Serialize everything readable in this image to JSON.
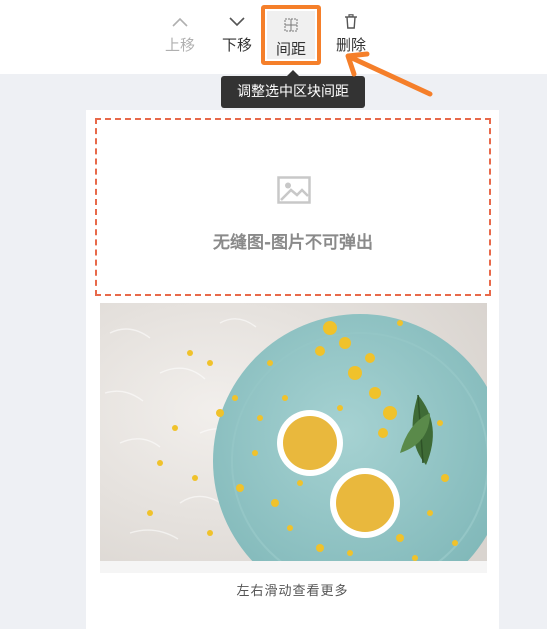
{
  "toolbar": {
    "move_up": {
      "label": "上移",
      "icon": "chevron-up-icon",
      "disabled": true
    },
    "move_down": {
      "label": "下移",
      "icon": "chevron-down-icon"
    },
    "spacing": {
      "label": "间距",
      "icon": "grid-icon",
      "highlight_color": "#f57f2a"
    },
    "delete": {
      "label": "删除",
      "icon": "trash-icon"
    }
  },
  "tooltip": {
    "text": "调整选中区块间距"
  },
  "block": {
    "placeholder_text": "无缝图-图片不可弹出",
    "placeholder_icon": "image-icon",
    "border_color": "#e8694a"
  },
  "gallery": {
    "caption": "左右滑动查看更多"
  },
  "colors": {
    "accent": "#f57f2a",
    "canvas_bg": "#eef0f4",
    "tooltip_bg": "#333333"
  }
}
